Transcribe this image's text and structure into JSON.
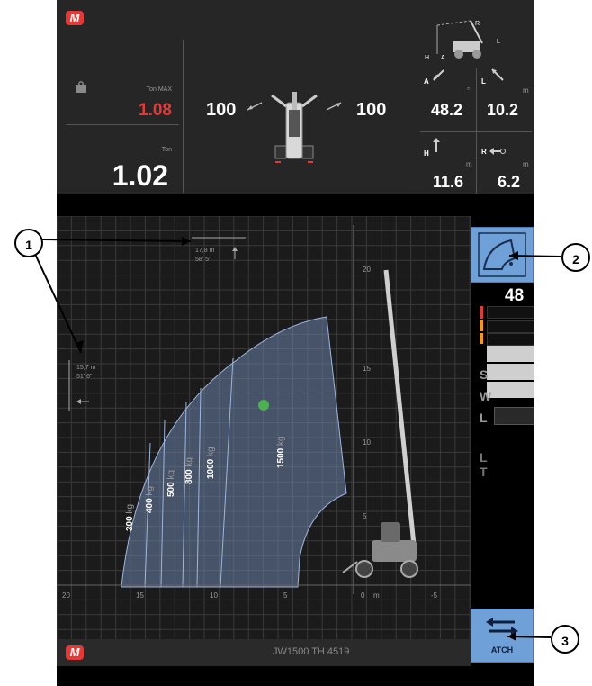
{
  "header": {
    "ton_max_label": "Ton MAX",
    "ton_max_value": "1.08",
    "ton_label": "Ton",
    "ton_value": "1.02",
    "left_percent": "100",
    "right_percent": "100",
    "percent_symbol": "%",
    "angle_a_label": "A",
    "length_l_label": "L",
    "angle_unit": "°",
    "meter_unit": "m",
    "angle_a_value": "48.2",
    "length_l_value": "10.2",
    "height_h_label": "H",
    "reach_r_label": "R",
    "height_value": "11.6",
    "reach_value": "6.2"
  },
  "chart": {
    "reach_marker_m": "17,8 m",
    "reach_marker_ft": "58' 5\"",
    "height_marker_m": "15,7 m",
    "height_marker_ft": "51' 6\"",
    "x_axis_ticks": [
      "20",
      "15",
      "10",
      "5",
      "0",
      "m",
      "-5"
    ],
    "y_axis_ticks": [
      "20",
      "15",
      "10",
      "5"
    ],
    "load_zones": [
      "300",
      "400",
      "500",
      "800",
      "1000",
      "1500"
    ],
    "load_unit": "kg"
  },
  "side_panel": {
    "boom_angle_value": "48",
    "lights_labels": [
      "S",
      "W",
      "L",
      "L",
      "T"
    ],
    "attachment_button_label": "ATCH"
  },
  "footer": {
    "model_text": "JW1500 TH 4519"
  },
  "callouts": [
    "1",
    "2",
    "3"
  ],
  "colors": {
    "accent_blue": "#6fa0d8",
    "brand_red": "#e53935",
    "load_zone_fill": "#6b82a8",
    "load_point": "#4caf50"
  }
}
